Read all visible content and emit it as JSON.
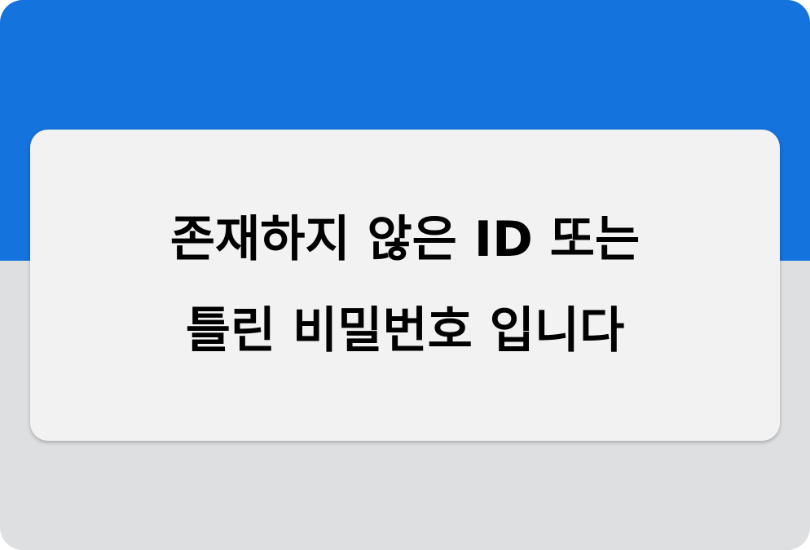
{
  "colors": {
    "header_background": "#1473dc",
    "page_background": "#dedfe1",
    "dialog_background": "#f2f2f3",
    "text": "#000000"
  },
  "dialog": {
    "message_line_1": "존재하지 않은 ID 또는",
    "message_line_2": "틀린 비밀번호 입니다"
  }
}
